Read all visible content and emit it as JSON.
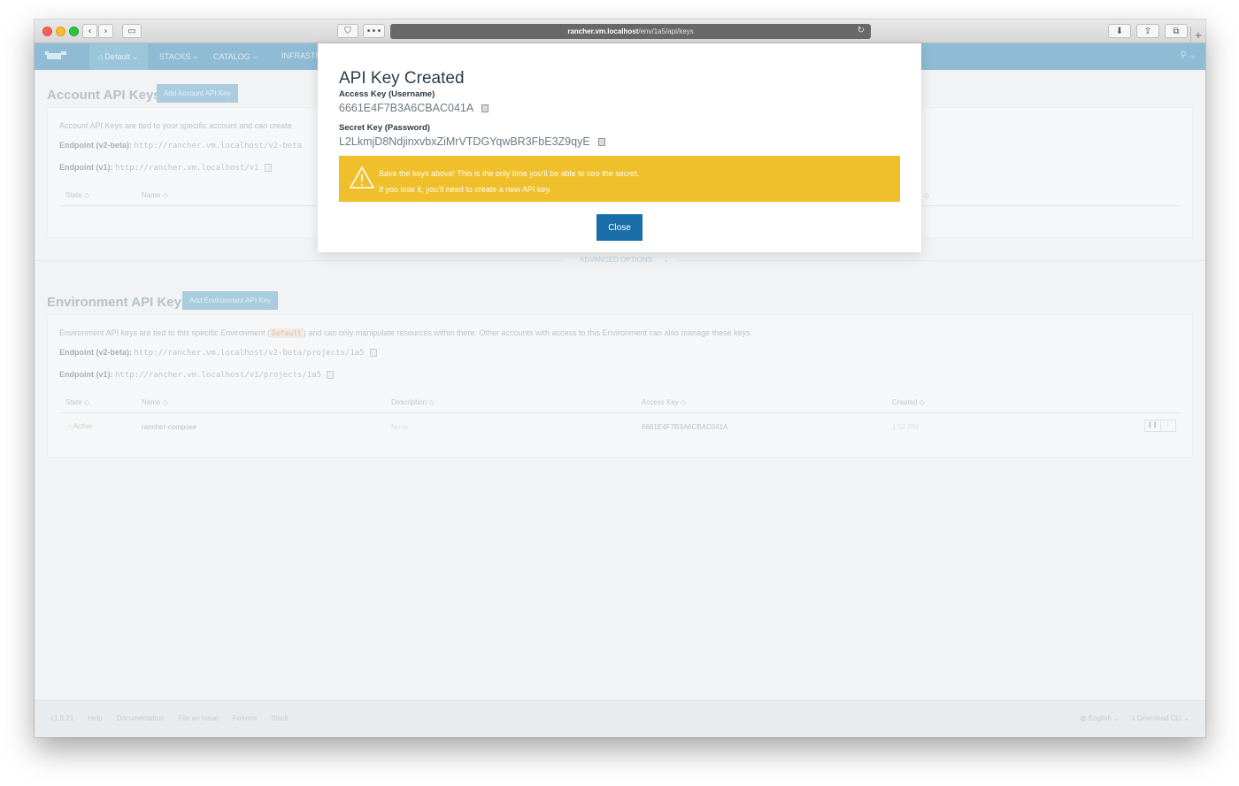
{
  "browser": {
    "url_host": "rancher.vm.localhost",
    "url_path": "/env/1a5/api/keys"
  },
  "nav": {
    "environment": "Default",
    "items": [
      "STACKS",
      "CATALOG",
      "INFRASTR"
    ]
  },
  "account_section": {
    "title": "Account API Keys",
    "add_button": "Add Account API Key",
    "description": "Account API Keys are tied to your specific account and can create",
    "endpoint_v2_label": "Endpoint (v2-beta):",
    "endpoint_v2_value": "http://rancher.vm.localhost/v2-beta",
    "endpoint_v1_label": "Endpoint (v1):",
    "endpoint_v1_value": "http://rancher.vm.localhost/v1",
    "columns": [
      "State",
      "Name"
    ]
  },
  "advanced_options": "ADVANCED OPTIONS",
  "environment_section": {
    "title": "Environment API Keys",
    "add_button": "Add Environment API Key",
    "description_pre": "Environment API keys are tied to this specific Environment (",
    "description_env": "Default",
    "description_post": ") and can only manipulate resources within there. Other accounts with access to this Environment can also manage these keys.",
    "endpoint_v2_label": "Endpoint (v2-beta):",
    "endpoint_v2_value": "http://rancher.vm.localhost/v2-beta/projects/1a5",
    "endpoint_v1_label": "Endpoint (v1):",
    "endpoint_v1_value": "http://rancher.vm.localhost/v1/projects/1a5",
    "columns": [
      "State",
      "Name",
      "Description",
      "Access Key",
      "Created"
    ],
    "rows": [
      {
        "state": "Active",
        "name": "rancher-compose",
        "description": "None",
        "access_key": "6661E4F7B3A6CBAC041A",
        "created": "1:52 PM"
      }
    ]
  },
  "footer": {
    "links": [
      "v1.6.21",
      "Help",
      "Documentation",
      "File an Issue",
      "Forums",
      "Slack"
    ],
    "language": "English",
    "download": "Download CLI"
  },
  "modal": {
    "title": "API Key Created",
    "access_label": "Access Key (Username)",
    "access_value": "6661E4F7B3A6CBAC041A",
    "secret_label": "Secret Key (Password)",
    "secret_value": "L2LkmjD8NdjinxvbxZiMrVTDGYqwBR3FbE3Z9qyE",
    "warning_line1": "Save the keys above! This is the only time you'll be able to see the secret.",
    "warning_line2": "If you lose it, you'll need to create a new API key.",
    "close_label": "Close"
  },
  "colors": {
    "nav": "#8fbcd4",
    "warning": "#f0c02c",
    "primary_button": "#1b6fa8"
  }
}
